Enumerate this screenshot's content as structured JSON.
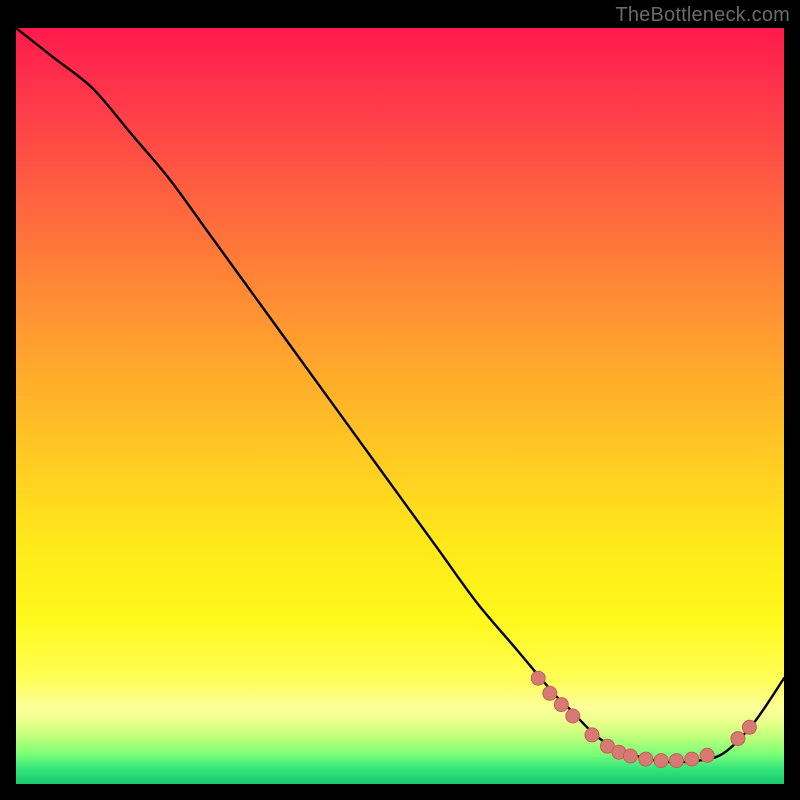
{
  "watermark": "TheBottleneck.com",
  "colors": {
    "frame_bg": "#000000",
    "curve": "#000000",
    "marker_fill": "#d77a74",
    "marker_stroke": "#c25f58",
    "gradient_top": "#ff1a4d",
    "gradient_mid": "#ffe81a",
    "gradient_bottom": "#16c96f"
  },
  "chart_data": {
    "type": "line",
    "title": "",
    "xlabel": "",
    "ylabel": "",
    "xlim": [
      0,
      100
    ],
    "ylim": [
      0,
      100
    ],
    "grid": false,
    "legend": false,
    "series": [
      {
        "name": "bottleneck-curve",
        "x": [
          0,
          5,
          10,
          15,
          20,
          25,
          30,
          35,
          40,
          45,
          50,
          55,
          60,
          65,
          70,
          72,
          76,
          80,
          84,
          88,
          92,
          96,
          100
        ],
        "values": [
          100,
          96,
          92,
          86,
          80,
          73,
          66,
          59,
          52,
          45,
          38,
          31,
          24,
          18,
          12,
          10,
          6,
          4,
          3,
          3,
          4,
          8,
          14
        ]
      }
    ],
    "markers": [
      {
        "x": 68.0,
        "y": 14.0
      },
      {
        "x": 69.5,
        "y": 12.0
      },
      {
        "x": 71.0,
        "y": 10.5
      },
      {
        "x": 72.5,
        "y": 9.0
      },
      {
        "x": 75.0,
        "y": 6.5
      },
      {
        "x": 77.0,
        "y": 5.0
      },
      {
        "x": 78.5,
        "y": 4.2
      },
      {
        "x": 80.0,
        "y": 3.7
      },
      {
        "x": 82.0,
        "y": 3.3
      },
      {
        "x": 84.0,
        "y": 3.1
      },
      {
        "x": 86.0,
        "y": 3.1
      },
      {
        "x": 88.0,
        "y": 3.3
      },
      {
        "x": 90.0,
        "y": 3.8
      },
      {
        "x": 94.0,
        "y": 6.0
      },
      {
        "x": 95.5,
        "y": 7.5
      }
    ]
  }
}
